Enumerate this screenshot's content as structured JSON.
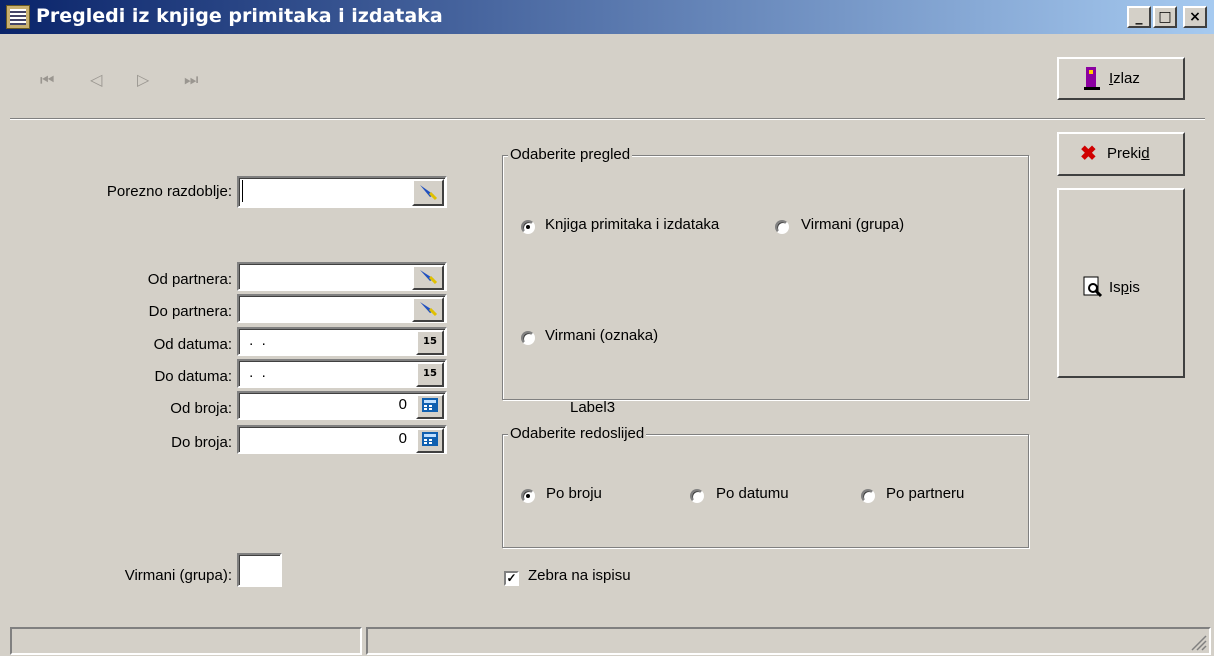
{
  "window": {
    "title": "Pregledi iz knjige primitaka i izdataka",
    "controls": {
      "minimize": "_",
      "maximize": "□",
      "close": "×"
    }
  },
  "nav": {
    "first": "⏮",
    "prev": "◁",
    "next": "▷",
    "last": "⏭"
  },
  "buttons": {
    "izlaz": {
      "pre": "",
      "key": "I",
      "post": "zlaz"
    },
    "prekid": {
      "pre": "Preki",
      "key": "d",
      "post": ""
    },
    "ispis": {
      "pre": "Is",
      "key": "p",
      "post": "is"
    }
  },
  "form": {
    "porezno_razdoblje": {
      "label": "Porezno razdoblje:",
      "value": ""
    },
    "od_partnera": {
      "label": "Od partnera:",
      "value": ""
    },
    "do_partnera": {
      "label": "Do partnera:",
      "value": ""
    },
    "od_datuma": {
      "label": "Od datuma:",
      "value": " .  ."
    },
    "do_datuma": {
      "label": "Do datuma:",
      "value": " .  ."
    },
    "od_broja": {
      "label": "Od broja:",
      "value": "0"
    },
    "do_broja": {
      "label": "Do broja:",
      "value": "0"
    },
    "virmani_grupa": {
      "label": "Virmani (grupa):",
      "value": ""
    },
    "calendar_icon_text": "15"
  },
  "pregled": {
    "title": "Odaberite pregled",
    "options": [
      {
        "label": "Knjiga primitaka i izdataka",
        "selected": true
      },
      {
        "label": "Virmani (grupa)",
        "selected": false
      },
      {
        "label": "Virmani (oznaka)",
        "selected": false
      }
    ]
  },
  "label3": "Label3",
  "redoslijed": {
    "title": "Odaberite redoslijed",
    "options": [
      {
        "label": "Po broju",
        "selected": true
      },
      {
        "label": "Po datumu",
        "selected": false
      },
      {
        "label": "Po partneru",
        "selected": false
      }
    ]
  },
  "zebra": {
    "label": "Zebra na ispisu",
    "checked": true
  }
}
